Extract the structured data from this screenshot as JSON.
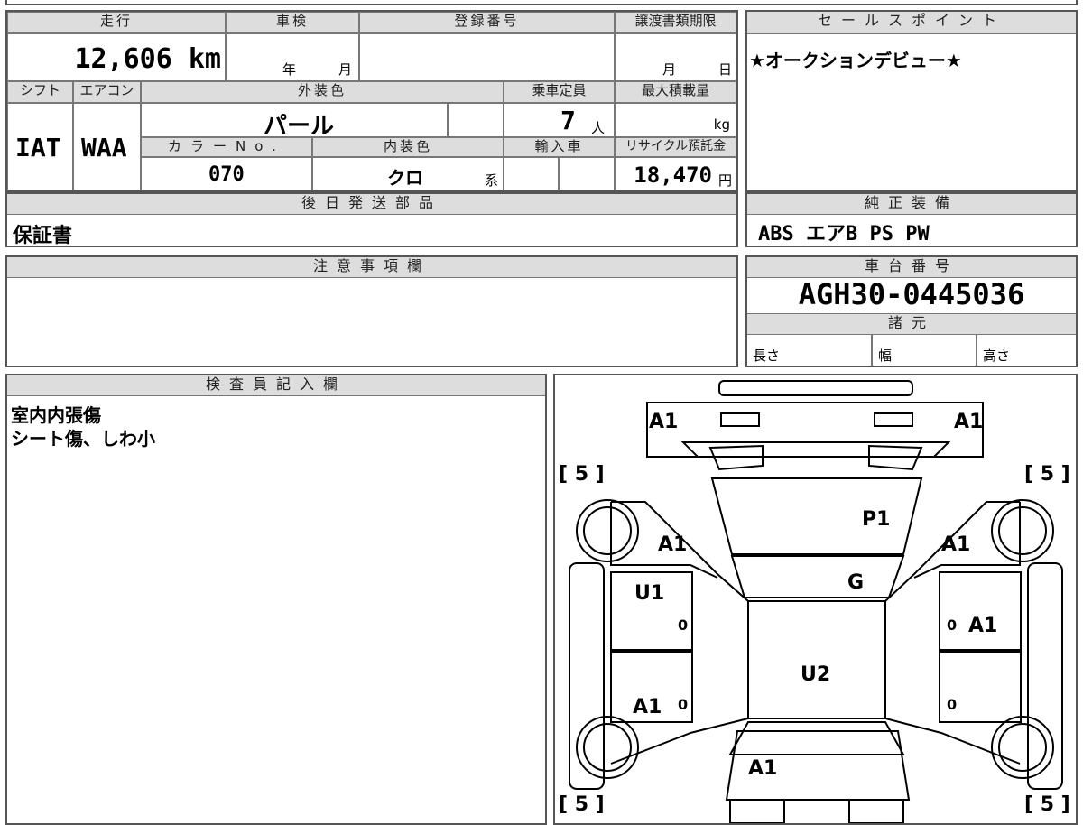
{
  "headers": {
    "mileage": "走行",
    "inspection": "車検",
    "registration": "登録番号",
    "transfer_deadline": "譲渡書類期限",
    "sales_point": "セールスポイント",
    "shift": "シフト",
    "aircon": "エアコン",
    "exterior_color": "外装色",
    "capacity": "乗車定員",
    "max_load": "最大積載量",
    "color_no": "カラーNo.",
    "interior_color": "内装色",
    "import": "輸入車",
    "recycle": "リサイクル預託金",
    "later_parts": "後日発送部品",
    "standard_equipment": "純正装備",
    "notes": "注意事項欄",
    "chassis_no": "車台番号",
    "specs": "諸元",
    "inspector": "検査員記入欄"
  },
  "values": {
    "mileage": "12,606 km",
    "year_unit": "年",
    "month_unit": "月",
    "deadline_month": "月",
    "deadline_day": "日",
    "sales_point": "★オークションデビュー★",
    "shift": "IAT",
    "aircon": "WAA",
    "exterior_color": "パール",
    "capacity": "7",
    "capacity_unit": "人",
    "max_load_unit": "kg",
    "color_no": "070",
    "interior_color": "クロ",
    "interior_suffix": "系",
    "recycle": "18,470",
    "recycle_unit": "円",
    "later_parts": "保証書",
    "standard_equipment": "ABS エアB PS PW",
    "chassis_no": "AGH30-0445036",
    "length": "長さ",
    "width": "幅",
    "height": "高さ",
    "inspector_line1": "室内内張傷",
    "inspector_line2": "シート傷、しわ小"
  },
  "diagram": {
    "marks": {
      "front_left": "A1",
      "front_right": "A1",
      "hood": "P1",
      "windshield": "G",
      "left_fender": "A1",
      "right_fender": "A1",
      "left_front_door": "U1",
      "right_front_door": "A1",
      "roof": "U2",
      "left_rear_door": "A1",
      "rear": "A1",
      "tire_fl": "[ 5 ]",
      "tire_fr": "[ 5 ]",
      "tire_rl": "[ 5 ]",
      "tire_rr": "[ 5 ]",
      "zero_lf": "0",
      "zero_rf": "0",
      "zero_lr": "0",
      "zero_rr": "0"
    }
  }
}
